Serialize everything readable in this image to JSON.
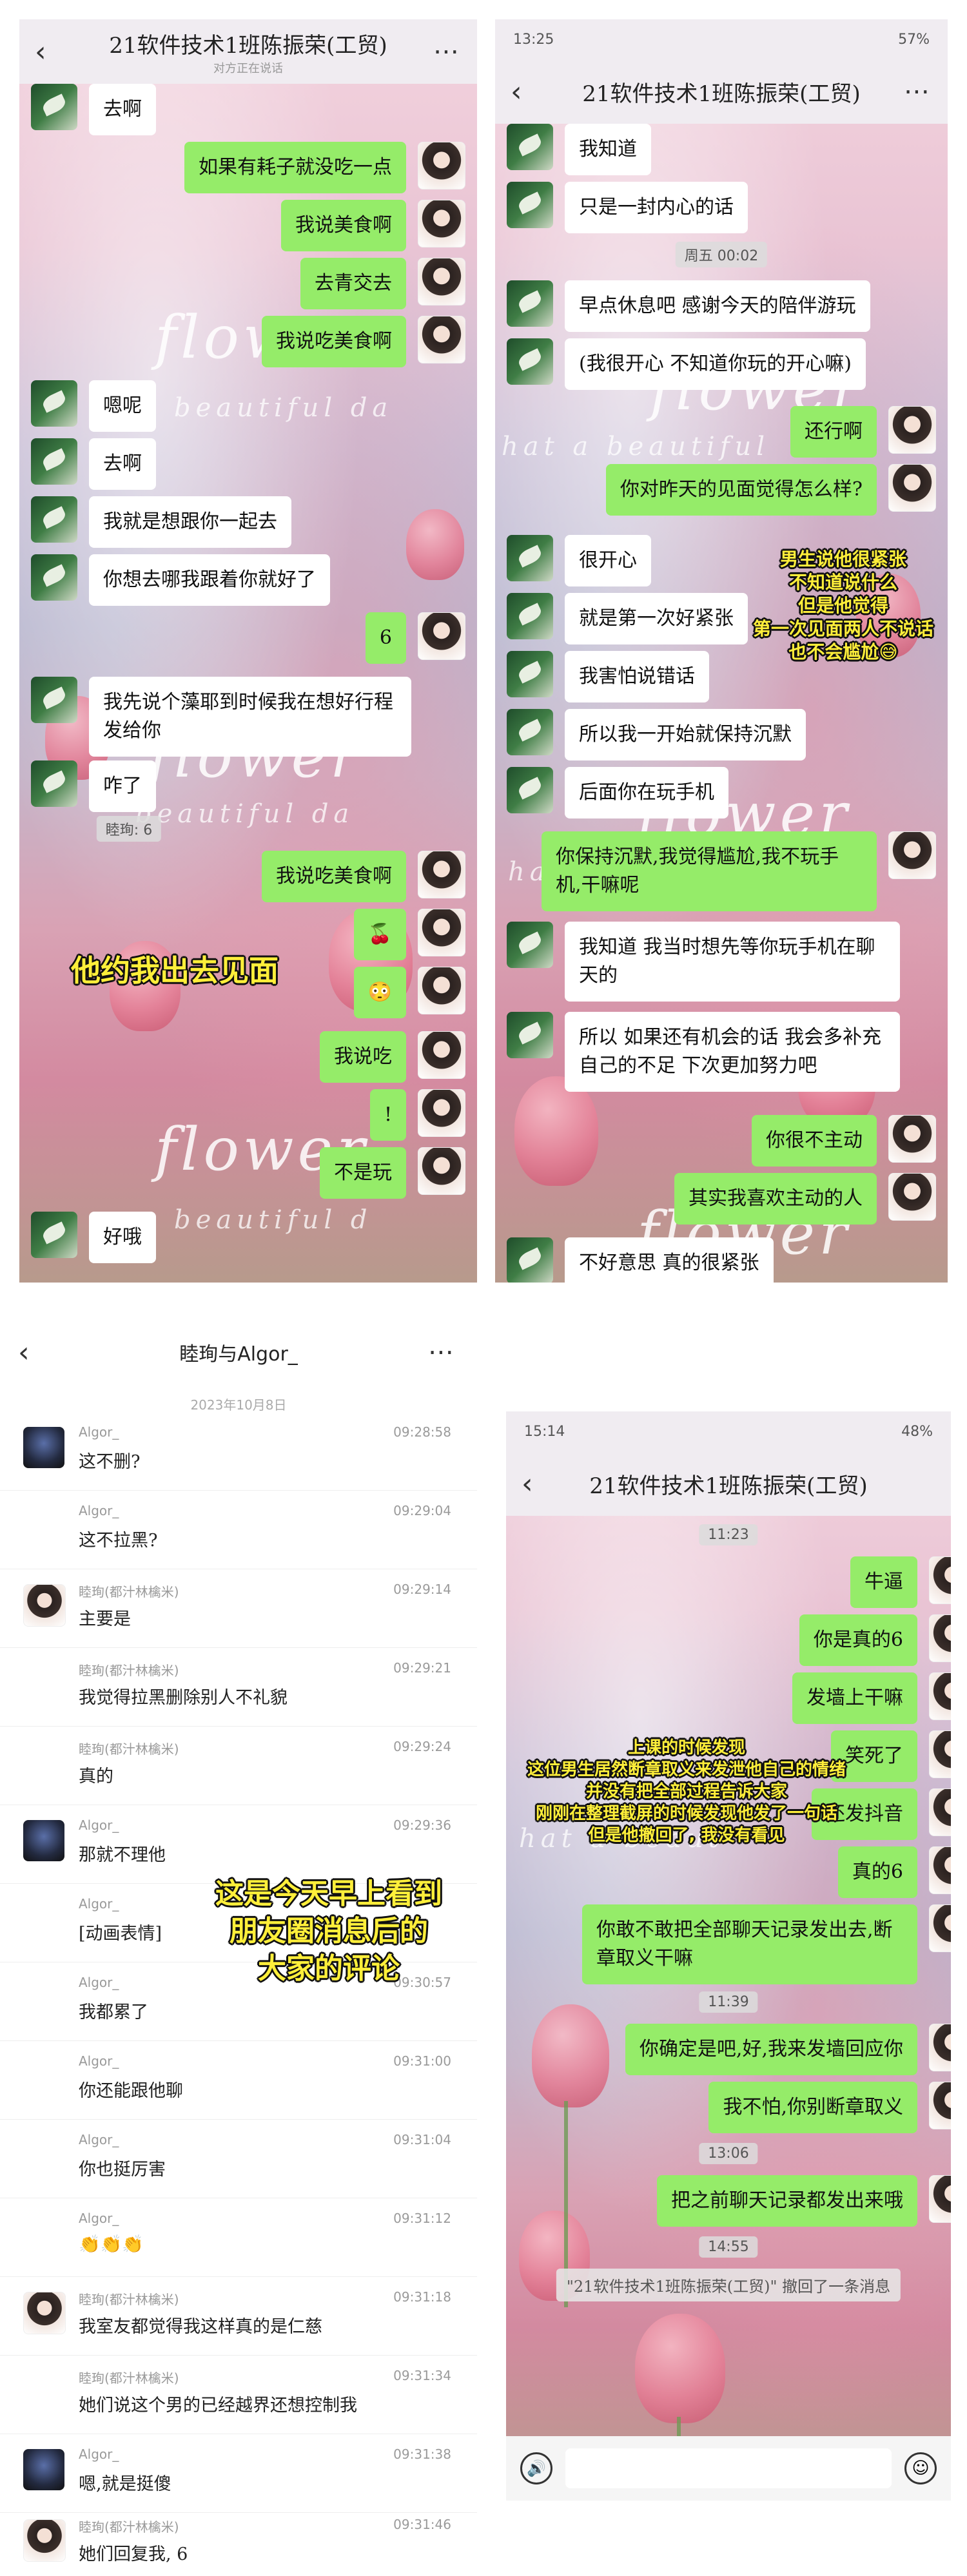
{
  "panel1": {
    "title": "21软件技术1班陈振荣(工贸)",
    "subtitle": "对方正在说话",
    "messages": [
      {
        "side": "left",
        "text": "去啊"
      },
      {
        "side": "right",
        "text": "如果有耗子就没吃一点"
      },
      {
        "side": "right",
        "text": "我说美食啊"
      },
      {
        "side": "right",
        "text": "去青交去"
      },
      {
        "side": "right",
        "text": "我说吃美食啊"
      },
      {
        "side": "left",
        "text": "嗯呢"
      },
      {
        "side": "left",
        "text": "去啊"
      },
      {
        "side": "left",
        "text": "我就是想跟你一起去"
      },
      {
        "side": "left",
        "text": "你想去哪我跟着你就好了"
      },
      {
        "side": "right",
        "text": "6"
      },
      {
        "side": "left",
        "text": "我先说个藻耶到时候我在想好行程发给你"
      },
      {
        "side": "left",
        "text": "咋了"
      },
      {
        "side": "right",
        "text": "我说吃美食啊"
      },
      {
        "side": "right",
        "text": "🍒"
      },
      {
        "side": "right",
        "text": "😳"
      },
      {
        "side": "right",
        "text": "我说吃"
      },
      {
        "side": "right",
        "text": "!"
      },
      {
        "side": "right",
        "text": "不是玩"
      },
      {
        "side": "left",
        "text": "好哦"
      }
    ],
    "pat_notice": "睦珣: 6",
    "caption": "他约我出去见面"
  },
  "panel2": {
    "status_time": "13:25",
    "status_right": "57%",
    "title": "21软件技术1班陈振荣(工贸)",
    "time_pill": "周五 00:02",
    "messages": [
      {
        "side": "left",
        "text": "我知道"
      },
      {
        "side": "left",
        "text": "只是一封内心的话"
      },
      {
        "side": "left",
        "text": "早点休息吧 感谢今天的陪伴游玩"
      },
      {
        "side": "left",
        "text": "(我很开心 不知道你玩的开心嘛)"
      },
      {
        "side": "right",
        "text": "还行啊"
      },
      {
        "side": "right",
        "text": "你对昨天的见面觉得怎么样?"
      },
      {
        "side": "left",
        "text": "很开心"
      },
      {
        "side": "left",
        "text": "就是第一次好紧张"
      },
      {
        "side": "left",
        "text": "我害怕说错话"
      },
      {
        "side": "left",
        "text": "所以我一开始就保持沉默"
      },
      {
        "side": "left",
        "text": "后面你在玩手机"
      },
      {
        "side": "right",
        "text": "你保持沉默,我觉得尴尬,我不玩手机,干嘛呢"
      },
      {
        "side": "left",
        "text": "我知道 我当时想先等你玩手机在聊天的"
      },
      {
        "side": "left",
        "text": "所以 如果还有机会的话 我会多补充自己的不足 下次更加努力吧"
      },
      {
        "side": "right",
        "text": "你很不主动"
      },
      {
        "side": "right",
        "text": "其实我喜欢主动的人"
      },
      {
        "side": "left",
        "text": "不好意思 真的很紧张"
      }
    ],
    "caption": "男生说他很紧张\n不知道说什么\n但是他觉得\n第一次见面两人不说话\n也不会尴尬😅"
  },
  "panel3": {
    "title": "睦珣与Algor_",
    "date": "2023年10月8日",
    "caption": "这是今天早上看到\n朋友圈消息后的\n大家的评论",
    "comments": [
      {
        "avatar": "dark",
        "name": "Algor_",
        "time": "09:28:58",
        "text": "这不删?"
      },
      {
        "avatar": "none",
        "name": "Algor_",
        "time": "09:29:04",
        "text": "这不拉黑?"
      },
      {
        "avatar": "girl",
        "name": "睦珣(都汁林檎米)",
        "time": "09:29:14",
        "text": "主要是"
      },
      {
        "avatar": "none",
        "name": "睦珣(都汁林檎米)",
        "time": "09:29:21",
        "text": "我觉得拉黑删除别人不礼貌"
      },
      {
        "avatar": "none",
        "name": "睦珣(都汁林檎米)",
        "time": "09:29:24",
        "text": "真的"
      },
      {
        "avatar": "dark",
        "name": "Algor_",
        "time": "09:29:36",
        "text": "那就不理他"
      },
      {
        "avatar": "none",
        "name": "Algor_",
        "time": "",
        "text": "[动画表情]"
      },
      {
        "avatar": "none",
        "name": "Algor_",
        "time": "09:30:57",
        "text": "我都累了"
      },
      {
        "avatar": "none",
        "name": "Algor_",
        "time": "09:31:00",
        "text": "你还能跟他聊"
      },
      {
        "avatar": "none",
        "name": "Algor_",
        "time": "09:31:04",
        "text": "你也挺厉害"
      },
      {
        "avatar": "none",
        "name": "Algor_",
        "time": "09:31:12",
        "text": "👏👏👏"
      },
      {
        "avatar": "girl",
        "name": "睦珣(都汁林檎米)",
        "time": "09:31:18",
        "text": "我室友都觉得我这样真的是仁慈"
      },
      {
        "avatar": "none",
        "name": "睦珣(都汁林檎米)",
        "time": "09:31:34",
        "text": "她们说这个男的已经越界还想控制我"
      },
      {
        "avatar": "dark",
        "name": "Algor_",
        "time": "09:31:38",
        "text": "嗯,就是挺傻"
      },
      {
        "avatar": "girl",
        "name": "睦珣(都汁林檎米)",
        "time": "09:31:46",
        "text": "她们回复我, 6"
      }
    ]
  },
  "panel4": {
    "status_time": "15:14",
    "status_right": "48%",
    "title": "21软件技术1班陈振荣(工贸)",
    "caption": "上课的时候发现\n这位男生居然断章取义来发泄他自己的情绪\n并没有把全部过程告诉大家\n刚刚在整理截屏的时候发现他发了一句话\n但是他撤回了, 我没有看见",
    "time_pills": [
      "11:23",
      "11:39",
      "13:06",
      "14:55"
    ],
    "messages": [
      {
        "side": "right",
        "text": "牛逼"
      },
      {
        "side": "right",
        "text": "你是真的6"
      },
      {
        "side": "right",
        "text": "发墙上干嘛"
      },
      {
        "side": "right",
        "text": "笑死了"
      },
      {
        "side": "right",
        "text": "还发抖音"
      },
      {
        "side": "right",
        "text": "真的6"
      },
      {
        "side": "right",
        "text": "你敢不敢把全部聊天记录发出去,断章取义干嘛"
      },
      {
        "side": "right",
        "text": "你确定是吧,好,我来发墙回应你"
      },
      {
        "side": "right",
        "text": "我不怕,你别断章取义"
      },
      {
        "side": "right",
        "text": "把之前聊天记录都发出来哦"
      }
    ],
    "recall_notice": "\"21软件技术1班陈振荣(工贸)\" 撤回了一条消息"
  }
}
